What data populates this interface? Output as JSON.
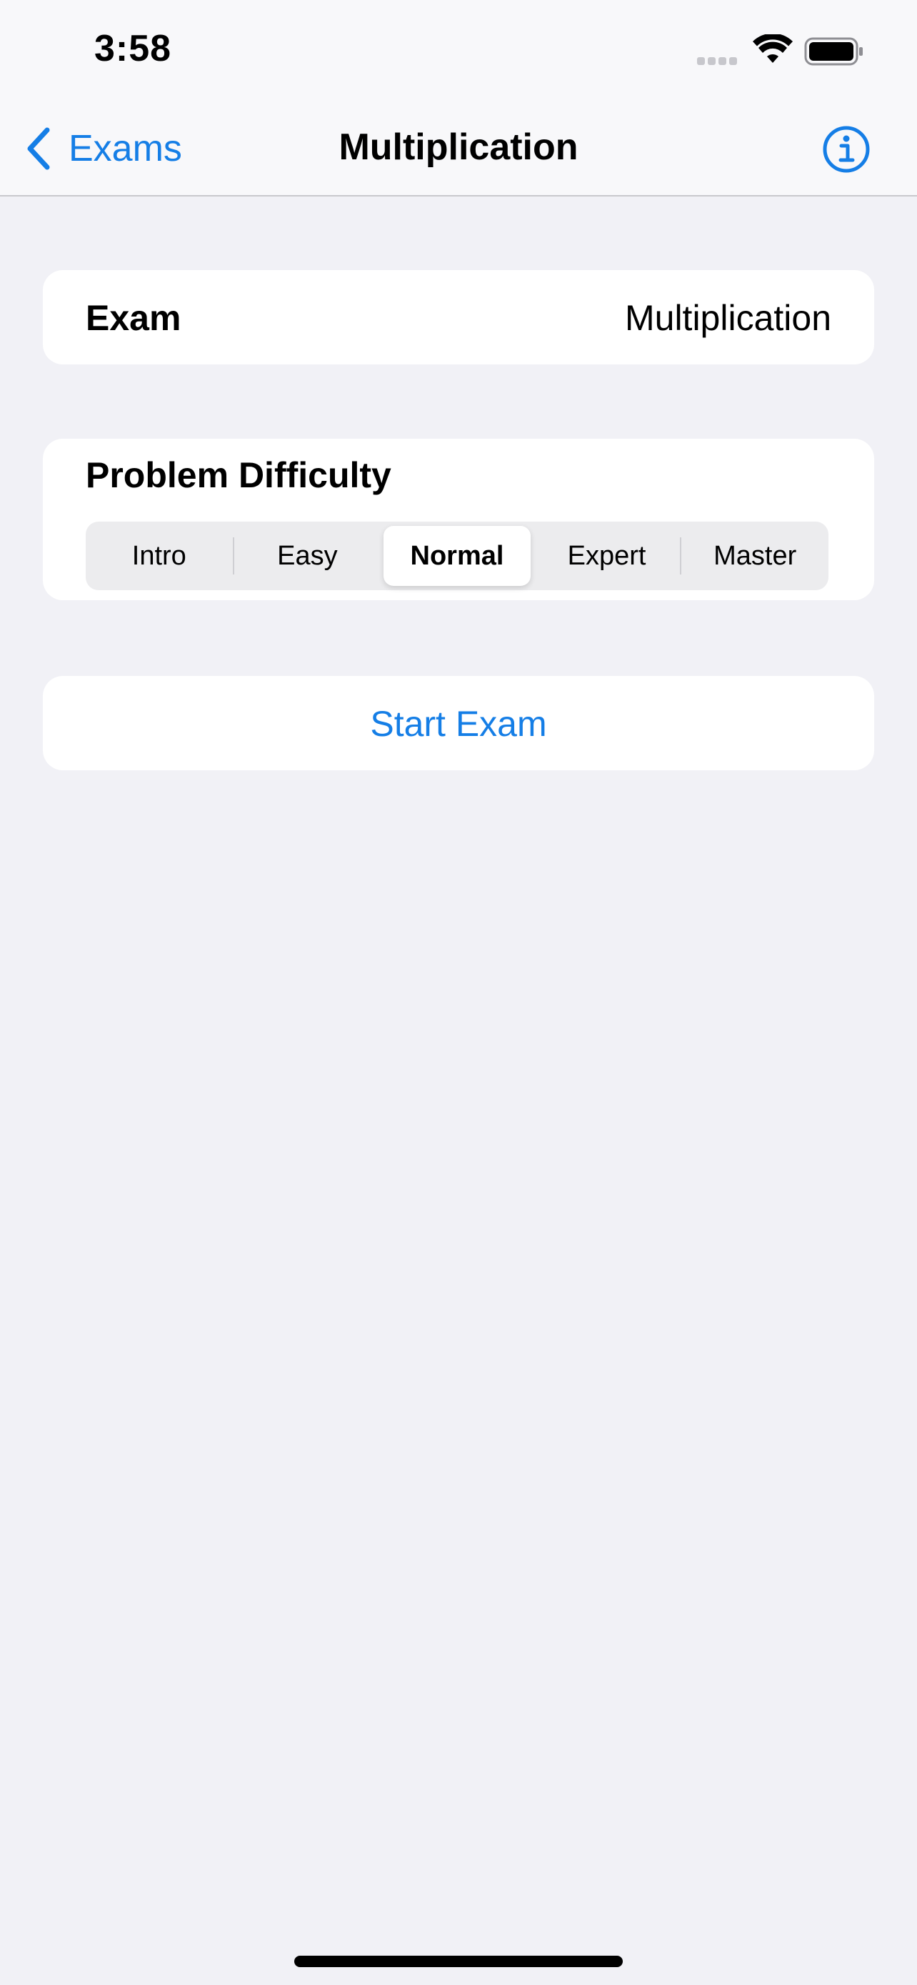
{
  "status_bar": {
    "time": "3:58"
  },
  "nav": {
    "back_label": "Exams",
    "title": "Multiplication",
    "info_icon": "info-circle-icon"
  },
  "exam_row": {
    "label": "Exam",
    "value": "Multiplication"
  },
  "difficulty": {
    "title": "Problem Difficulty",
    "options": [
      "Intro",
      "Easy",
      "Normal",
      "Expert",
      "Master"
    ],
    "selected": "Normal"
  },
  "start_button": {
    "label": "Start Exam"
  },
  "colors": {
    "accent": "#157ee6",
    "background": "#f1f1f6",
    "card": "#ffffff"
  }
}
